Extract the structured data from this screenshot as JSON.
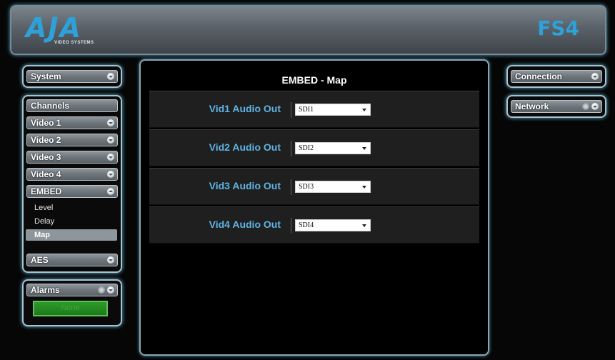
{
  "header": {
    "logo_text": "AJA",
    "logo_subtext": "VIDEO SYSTEMS",
    "product": "FS4"
  },
  "left_nav": {
    "system_label": "System",
    "channels_label": "Channels",
    "items": [
      {
        "label": "Video 1"
      },
      {
        "label": "Video 2"
      },
      {
        "label": "Video 3"
      },
      {
        "label": "Video 4"
      },
      {
        "label": "EMBED"
      }
    ],
    "embed_subitems": [
      {
        "label": "Level"
      },
      {
        "label": "Delay"
      },
      {
        "label": "Map",
        "active": true
      }
    ],
    "aes_label": "AES",
    "alarms_label": "Alarms",
    "alarms_status": "None"
  },
  "main": {
    "title": "EMBED - Map",
    "rows": [
      {
        "label": "Vid1 Audio Out",
        "value": "SDI1"
      },
      {
        "label": "Vid2 Audio Out",
        "value": "SDI2"
      },
      {
        "label": "Vid3 Audio Out",
        "value": "SDI3"
      },
      {
        "label": "Vid4 Audio Out",
        "value": "SDI4"
      }
    ]
  },
  "right_nav": {
    "connection_label": "Connection",
    "network_label": "Network"
  },
  "colors": {
    "accent": "#2ea1d8",
    "row_label": "#5fb3e3",
    "glow": "#5fb6d6",
    "alarm_green": "#1d7a1a"
  }
}
